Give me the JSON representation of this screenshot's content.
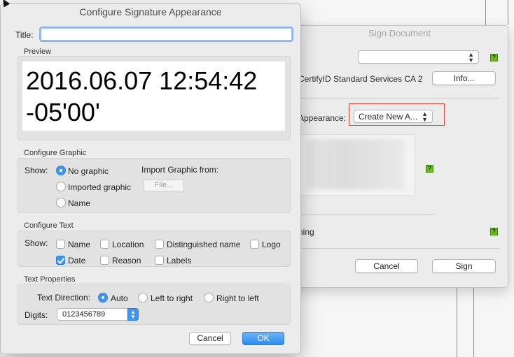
{
  "dialog": {
    "title": "Configure Signature Appearance",
    "title_label": "Title:",
    "title_value": "",
    "preview_header": "Preview",
    "preview_line1": "2016.06.07 12:54:42",
    "preview_line2": "-05'00'",
    "graphic": {
      "header": "Configure Graphic",
      "show_label": "Show:",
      "options": [
        {
          "label": "No graphic",
          "selected": true
        },
        {
          "label": "Imported graphic",
          "selected": false
        },
        {
          "label": "Name",
          "selected": false
        }
      ],
      "import_label": "Import Graphic from:",
      "file_button": "File..."
    },
    "text": {
      "header": "Configure Text",
      "show_label": "Show:",
      "items": [
        {
          "label": "Name",
          "checked": false
        },
        {
          "label": "Location",
          "checked": false
        },
        {
          "label": "Distinguished name",
          "checked": false
        },
        {
          "label": "Logo",
          "checked": false
        },
        {
          "label": "Date",
          "checked": true
        },
        {
          "label": "Reason",
          "checked": false
        },
        {
          "label": "Labels",
          "checked": false
        }
      ]
    },
    "properties": {
      "header": "Text Properties",
      "direction_label": "Text Direction:",
      "directions": [
        {
          "label": "Auto",
          "selected": true
        },
        {
          "label": "Left to right",
          "selected": false
        },
        {
          "label": "Right to left",
          "selected": false
        }
      ],
      "digits_label": "Digits:",
      "digits_value": "0123456789"
    },
    "cancel_button": "Cancel",
    "ok_button": "OK"
  },
  "sign_window": {
    "title": "Sign Document",
    "issuer_text": "CertifyID Standard Services CA 2",
    "info_button": "Info...",
    "appearance_label": "Appearance:",
    "appearance_value": "Create New A...",
    "signing_label": "ning",
    "help_icon_text": "?",
    "cancel_button": "Cancel",
    "sign_button": "Sign"
  },
  "colors": {
    "accent": "#3f95f0",
    "highlight_box": "#d9473d",
    "help_icon": "#6fbf1b"
  }
}
